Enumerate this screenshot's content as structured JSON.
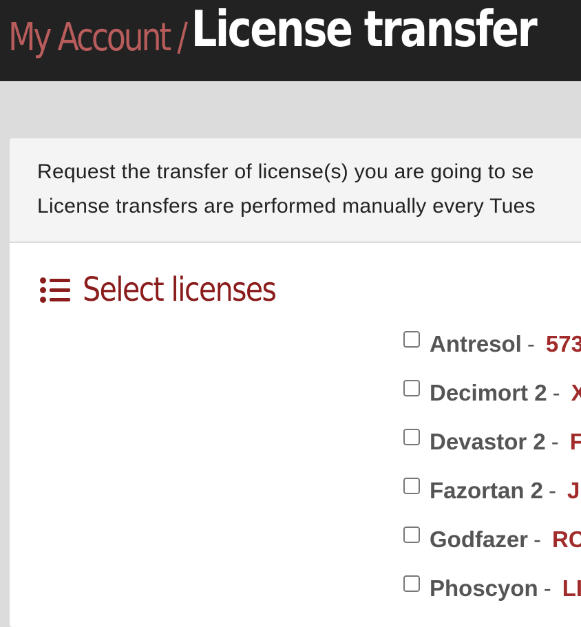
{
  "header": {
    "breadcrumb_parent": "My Account",
    "breadcrumb_separator": " /",
    "page_title": "License transfer"
  },
  "intro": {
    "line1": "Request the transfer of license(s) you are going to se",
    "line2": "License transfers are performed manually every Tues"
  },
  "section": {
    "icon": "list-icon",
    "title": "Select licenses"
  },
  "licenses": [
    {
      "name": "Antresol",
      "separator": "-",
      "key": "573",
      "checked": false
    },
    {
      "name": "Decimort 2",
      "separator": "-",
      "key": "X",
      "checked": false
    },
    {
      "name": "Devastor 2",
      "separator": "-",
      "key": "F",
      "checked": false
    },
    {
      "name": "Fazortan 2",
      "separator": "-",
      "key": "J",
      "checked": false
    },
    {
      "name": "Godfazer",
      "separator": "-",
      "key": "RC",
      "checked": false
    },
    {
      "name": "Phoscyon",
      "separator": "-",
      "key": "LI",
      "checked": false
    }
  ],
  "colors": {
    "header_bg": "#222222",
    "breadcrumb_parent": "#b95c5c",
    "accent": "#8a1c1c",
    "license_key": "#a12a2a",
    "page_bg": "#dcdcdc"
  }
}
